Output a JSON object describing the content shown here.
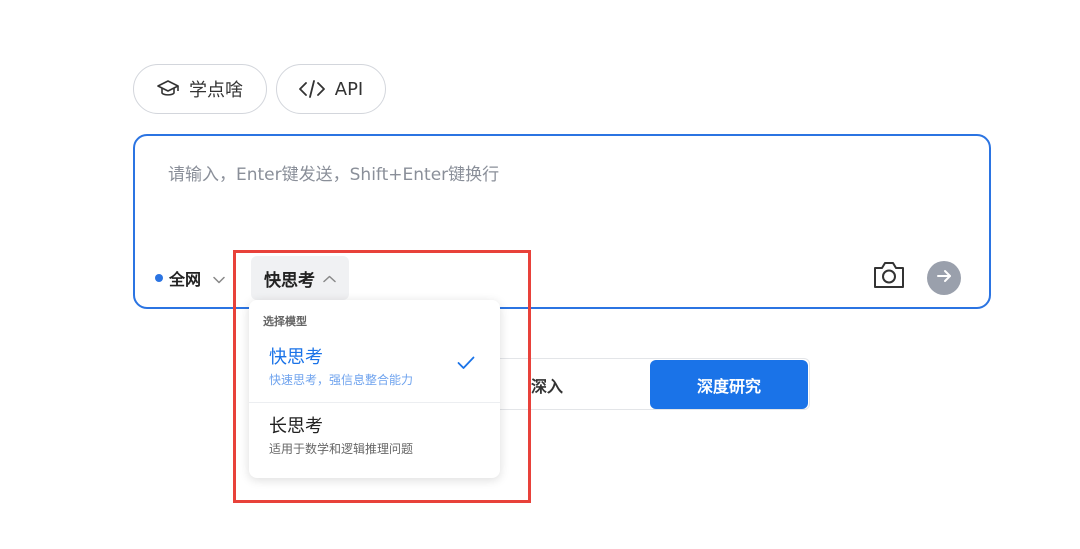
{
  "chips": {
    "learn_label": "学点啥",
    "api_label": "API"
  },
  "input": {
    "placeholder": "请输入，Enter键发送，Shift+Enter键换行",
    "web_scope": "全网",
    "model_selected": "快思考"
  },
  "modes": {
    "deep": "深入",
    "research": "深度研究"
  },
  "dropdown": {
    "header": "选择模型",
    "items": [
      {
        "title": "快思考",
        "desc": "快速思考，强信息整合能力",
        "selected": true
      },
      {
        "title": "长思考",
        "desc": "适用于数学和逻辑推理问题",
        "selected": false
      }
    ]
  },
  "colors": {
    "accent": "#1a73e8",
    "highlight_annotation": "#e8413a",
    "send_button": "#9aa0ac"
  },
  "icons": {
    "learn": "graduation-cap-icon",
    "api": "code-brackets-icon",
    "camera": "camera-icon",
    "send": "arrow-right-icon",
    "check": "check-icon",
    "chevron_up": "chevron-up-icon",
    "chevron_down": "chevron-down-icon"
  }
}
